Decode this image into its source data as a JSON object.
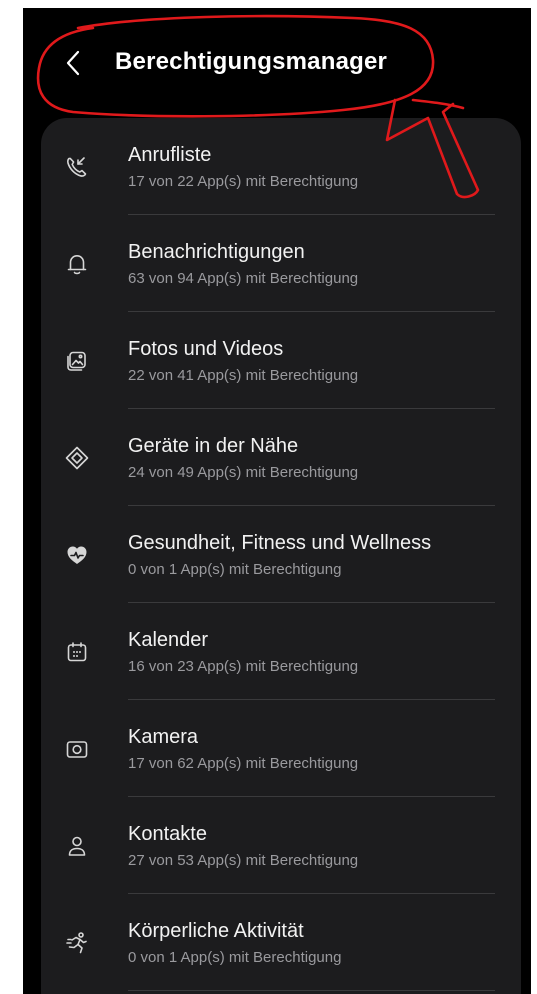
{
  "header": {
    "title": "Berechtigungsmanager",
    "back_icon": "chevron-left-icon"
  },
  "colors": {
    "background": "#000000",
    "card": "#1c1c1e",
    "text_primary": "#f2f2f2",
    "text_secondary": "#9a9a9e",
    "annotation": "#e0191b"
  },
  "items": [
    {
      "label": "Anrufliste",
      "sub": "17 von 22 App(s) mit Berechtigung",
      "icon": "call-log-icon"
    },
    {
      "label": "Benachrichtigungen",
      "sub": "63 von 94 App(s) mit Berechtigung",
      "icon": "bell-icon"
    },
    {
      "label": "Fotos und Videos",
      "sub": "22 von 41 App(s) mit Berechtigung",
      "icon": "photos-icon"
    },
    {
      "label": "Geräte in der Nähe",
      "sub": "24 von 49 App(s) mit Berechtigung",
      "icon": "nearby-devices-icon"
    },
    {
      "label": "Gesundheit, Fitness und Wellness",
      "sub": "0 von 1 App(s) mit Berechtigung",
      "icon": "health-icon"
    },
    {
      "label": "Kalender",
      "sub": "16 von 23 App(s) mit Berechtigung",
      "icon": "calendar-icon"
    },
    {
      "label": "Kamera",
      "sub": "17 von 62 App(s) mit Berechtigung",
      "icon": "camera-icon"
    },
    {
      "label": "Kontakte",
      "sub": "27 von 53 App(s) mit Berechtigung",
      "icon": "contacts-icon"
    },
    {
      "label": "Körperliche Aktivität",
      "sub": "0 von 1 App(s) mit Berechtigung",
      "icon": "physical-activity-icon"
    }
  ]
}
